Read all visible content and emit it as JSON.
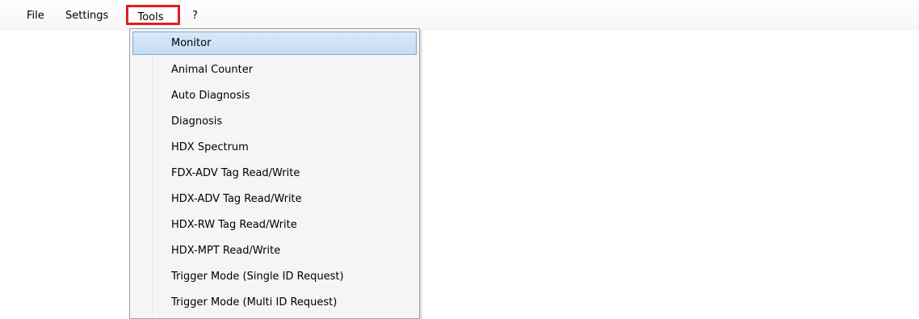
{
  "menubar": {
    "items": [
      {
        "label": "File"
      },
      {
        "label": "Settings"
      },
      {
        "label": "Tools"
      },
      {
        "label": "?"
      }
    ]
  },
  "tools_menu": {
    "items": [
      {
        "label": "Monitor"
      },
      {
        "label": "Animal Counter"
      },
      {
        "label": "Auto Diagnosis"
      },
      {
        "label": "Diagnosis"
      },
      {
        "label": "HDX Spectrum"
      },
      {
        "label": "FDX-ADV Tag Read/Write"
      },
      {
        "label": "HDX-ADV Tag Read/Write"
      },
      {
        "label": "HDX-RW Tag Read/Write"
      },
      {
        "label": "HDX-MPT Read/Write"
      },
      {
        "label": "Trigger Mode (Single ID Request)"
      },
      {
        "label": "Trigger Mode (Multi ID Request)"
      }
    ]
  },
  "colors": {
    "highlight_border": "#e21d24",
    "hover_fill": "#cce4f7",
    "hover_border": "#7aa9d9"
  }
}
